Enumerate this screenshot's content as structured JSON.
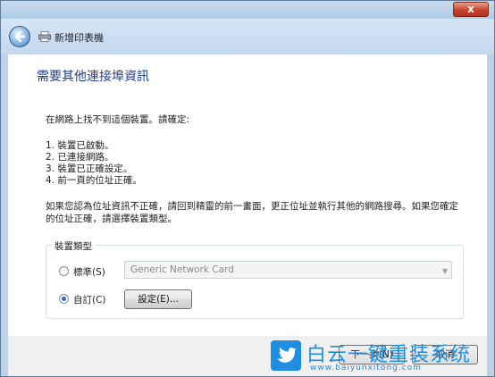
{
  "window": {
    "close_glyph": "x",
    "title": "新增印表機"
  },
  "heading": "需要其他連接埠資訊",
  "intro": "在網路上找不到這個裝置。請確定:",
  "checklist": [
    "1. 裝置已啟動。",
    "2. 已連接網路。",
    "3. 裝置已正確設定。",
    "4. 前一頁的位址正確。"
  ],
  "explanation": [
    "如果您認為位址資訊不正確，請回到精靈的前一畫面，更正位址並執行其他的網路搜尋。如果您確定",
    "的位址正確，請選擇裝置類型。"
  ],
  "device_type": {
    "legend": "裝置類型",
    "standard_label": "標準(S)",
    "standard_checked": false,
    "standard_value": "Generic Network Card",
    "custom_label": "自訂(C)",
    "custom_checked": true,
    "settings_button": "設定(E)..."
  },
  "footer": {
    "next_button": "下一步(N)",
    "cancel_button": "取消"
  },
  "watermark": {
    "title": "白云一键重装系统",
    "url": "www.baiyunxitong.com"
  },
  "colors": {
    "heading": "#1e3e8c",
    "watermark": "#1f8de0",
    "close": "#c8412c"
  }
}
